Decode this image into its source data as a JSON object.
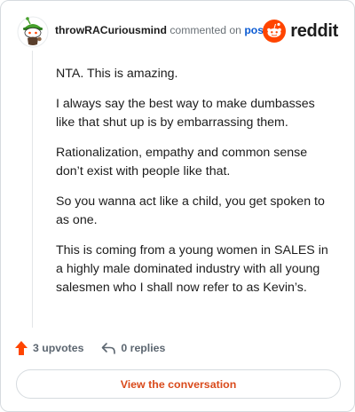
{
  "comment": {
    "username": "throwRACuriousmind",
    "action_text": "commented on",
    "post_link": "post",
    "paragraphs": [
      "NTA. This is amazing.",
      "I always say the best way to make dumbasses like that shut up is by embarrassing them.",
      "Rationalization, empathy and common sense don’t exist with people like that.",
      "So you wanna act like a child, you get spoken to as one.",
      "This is coming from a young women in SALES in a highly male dominated industry with all young salesmen who I shall now refer to as Kevin’s."
    ]
  },
  "brand": {
    "wordmark": "reddit",
    "color": "#ff4500"
  },
  "footer": {
    "upvotes": "3 upvotes",
    "replies": "0 replies"
  },
  "cta": {
    "label": "View the conversation",
    "color": "#d94a1b"
  },
  "icons": {
    "avatar": "snoo-avatar-icon",
    "logo": "reddit-alien-icon",
    "upvote": "upvote-arrow-icon",
    "reply": "reply-arrow-icon"
  }
}
